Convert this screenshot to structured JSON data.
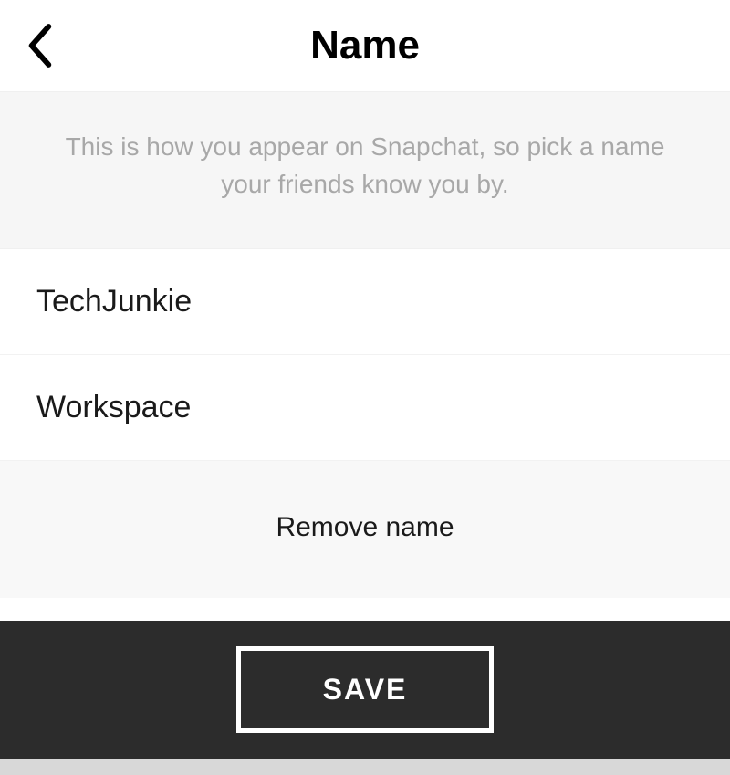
{
  "header": {
    "title": "Name"
  },
  "info": {
    "text": "This is how you appear on Snapchat, so pick a name your friends know you by."
  },
  "fields": {
    "first_name": "TechJunkie",
    "last_name": "Workspace"
  },
  "actions": {
    "remove_label": "Remove name",
    "save_label": "SAVE"
  }
}
